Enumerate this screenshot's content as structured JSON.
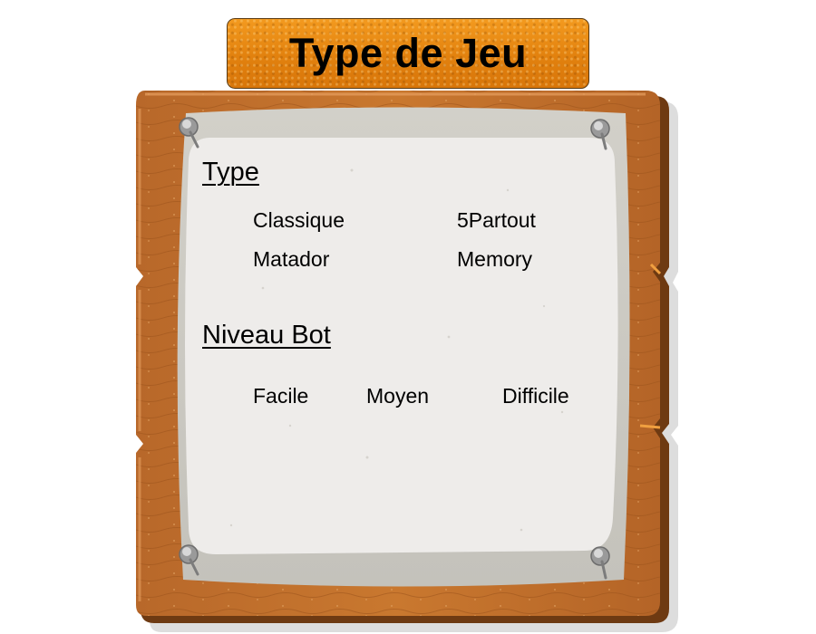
{
  "title": "Type de Jeu",
  "type_section": {
    "heading": "Type",
    "options": [
      "Classique",
      "5Partout",
      "Matador",
      "Memory"
    ]
  },
  "bot_section": {
    "heading": "Niveau Bot",
    "options": [
      "Facile",
      "Moyen",
      "Difficile"
    ]
  },
  "colors": {
    "banner_orange": "#e2810e",
    "wood_light": "#c9752f",
    "wood_dark": "#6e3a12",
    "paper": "#eeecea",
    "paper_border": "#cfcdc7"
  }
}
